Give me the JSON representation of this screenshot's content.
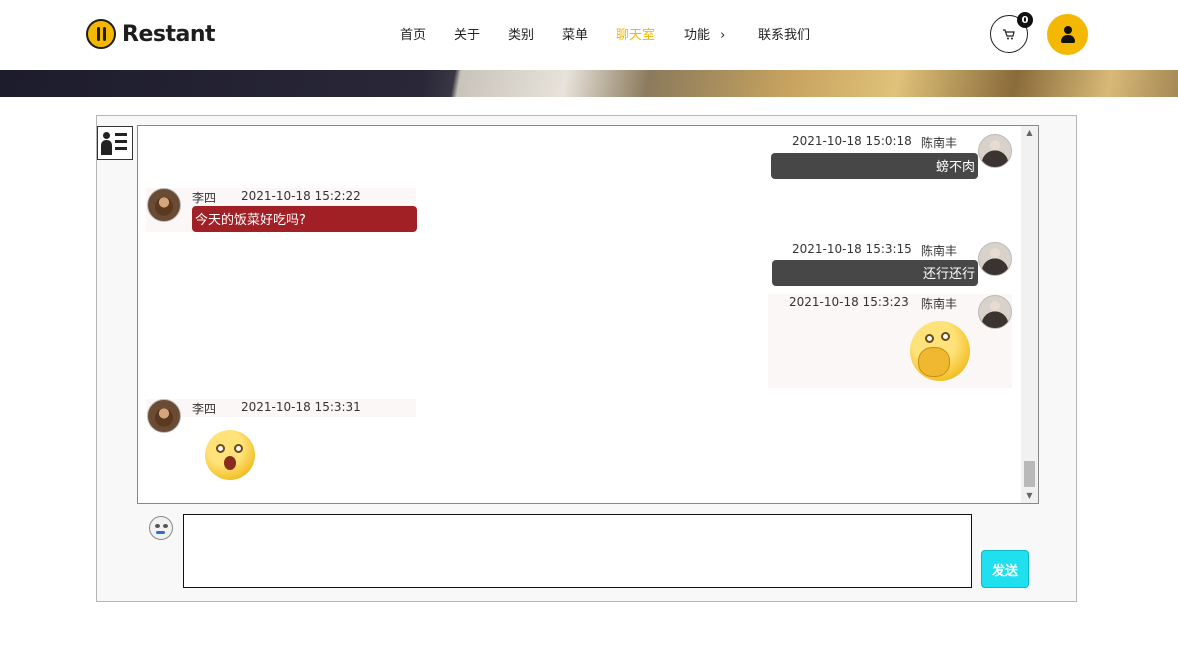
{
  "brand": {
    "name": "Restant",
    "logo_icon": "cutlery-icon",
    "accent": "#f5b800"
  },
  "nav": [
    {
      "label": "首页"
    },
    {
      "label": "关于"
    },
    {
      "label": "类别"
    },
    {
      "label": "菜单"
    },
    {
      "label": "聊天室",
      "active": true
    },
    {
      "label": "功能",
      "chevron": "›"
    },
    {
      "label": "联系我们"
    }
  ],
  "header": {
    "cart_count": "0",
    "cart_icon": "cart-icon",
    "user_icon": "user-icon"
  },
  "chat": {
    "messages": [
      {
        "side": "right",
        "sender": "陈南丰",
        "time": "2021-10-18 15:0:18",
        "text": "螃不肉"
      },
      {
        "side": "left",
        "sender": "李四",
        "time": "2021-10-18 15:2:22",
        "text": "今天的饭菜好吃吗?"
      },
      {
        "side": "right",
        "sender": "陈南丰",
        "time": "2021-10-18 15:3:15",
        "text": "还行还行"
      },
      {
        "side": "right",
        "sender": "陈南丰",
        "time": "2021-10-18 15:3:23",
        "sticker": "face-palm-emoji"
      },
      {
        "side": "left",
        "sender": "李四",
        "time": "2021-10-18 15:3:31",
        "sticker": "excited-emoji"
      }
    ],
    "input": {
      "value": "",
      "placeholder": ""
    },
    "send_label": "发送",
    "emoji_icon": "emoji-icon",
    "contacts_icon": "contacts-icon",
    "colors": {
      "own_bubble": "#474747",
      "other_bubble": "#a02025",
      "send_button": "#1fe0ee"
    }
  }
}
